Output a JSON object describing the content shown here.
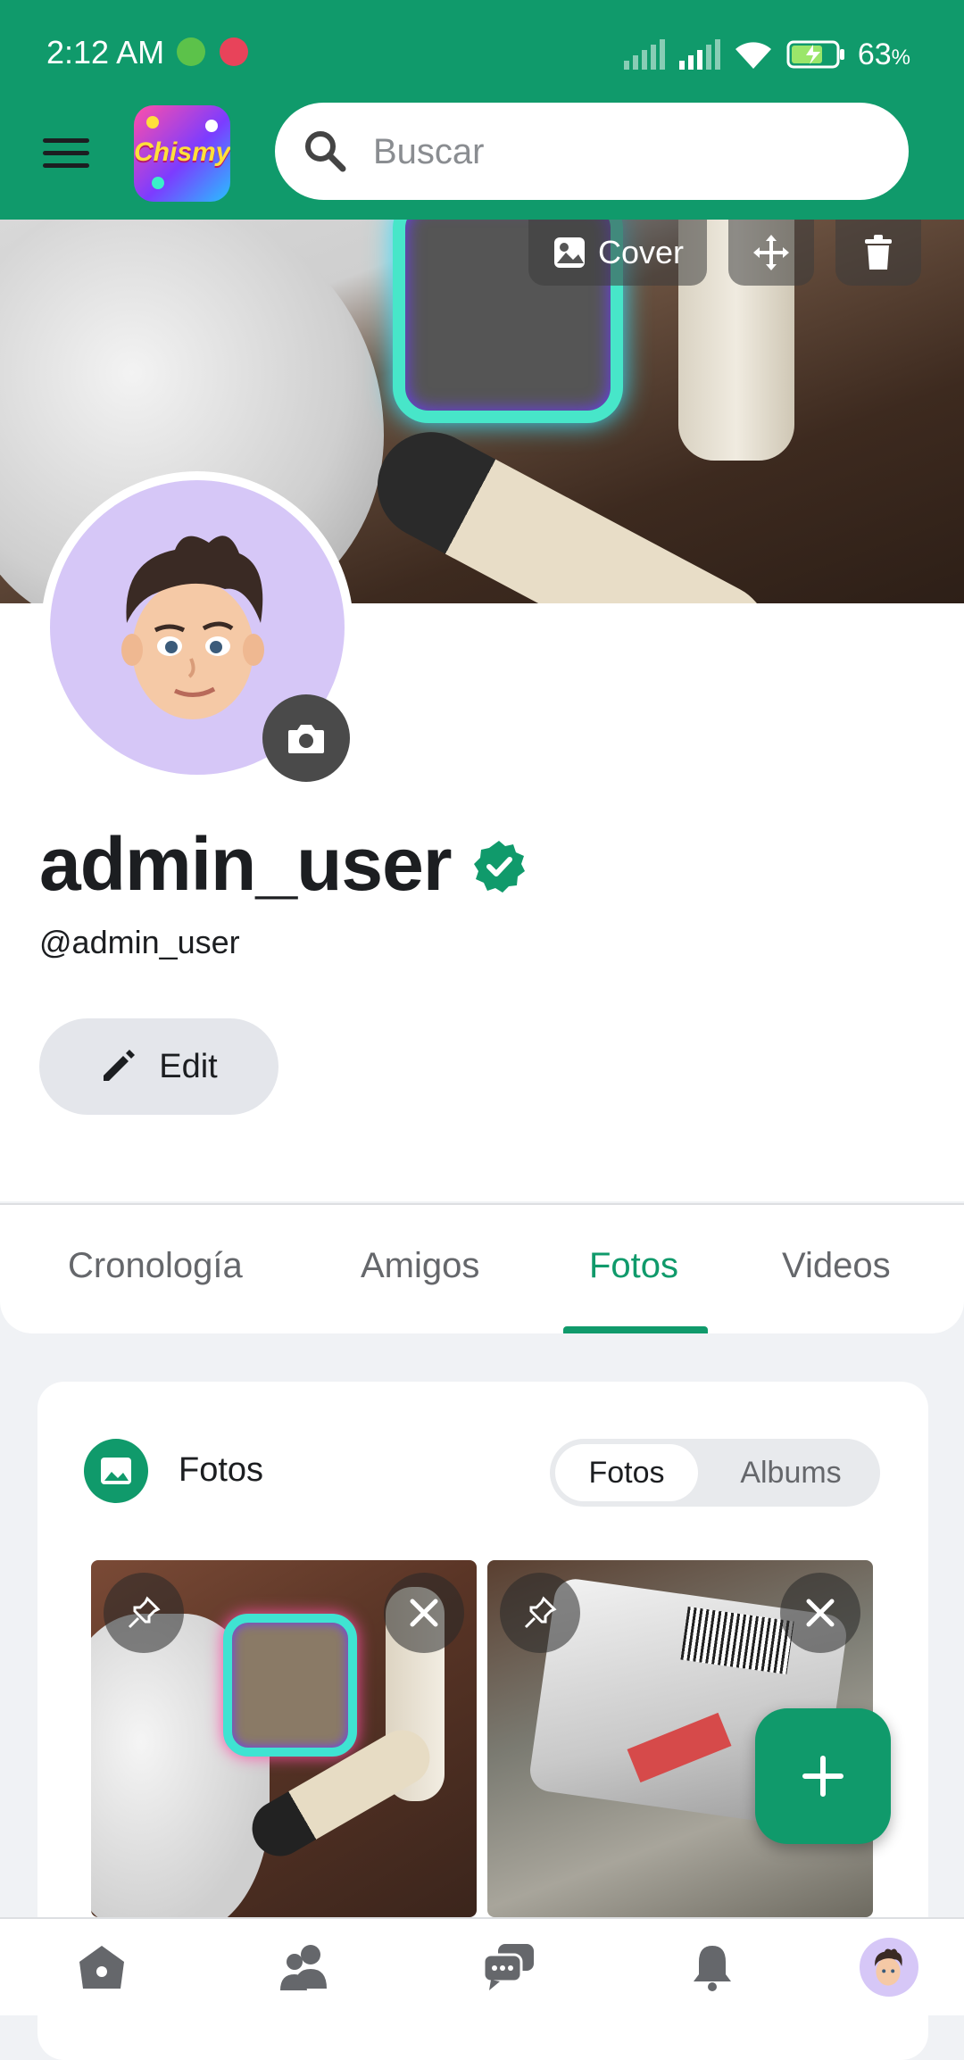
{
  "status_bar": {
    "time": "2:12 AM",
    "battery_percent": "63",
    "battery_unit": "%"
  },
  "app": {
    "logo_text": "Chismy",
    "search": {
      "placeholder": "Buscar"
    }
  },
  "cover": {
    "cover_button_label": "Cover"
  },
  "profile": {
    "display_name": "admin_user",
    "handle": "@admin_user",
    "verified": true,
    "edit_label": "Edit"
  },
  "tabs": [
    {
      "label": "Cronología",
      "active": false
    },
    {
      "label": "Amigos",
      "active": false
    },
    {
      "label": "Fotos",
      "active": true
    },
    {
      "label": "Videos",
      "active": false
    }
  ],
  "photos_card": {
    "title": "Fotos",
    "toggle": {
      "selected": "Fotos",
      "other": "Albums"
    },
    "photo_count_visible": 2
  },
  "bottom_nav": [
    {
      "icon": "home-icon"
    },
    {
      "icon": "friends-icon"
    },
    {
      "icon": "messages-icon"
    },
    {
      "icon": "notifications-icon"
    },
    {
      "icon": "profile-avatar"
    }
  ],
  "colors": {
    "brand": "#109a6b",
    "verified": "#109a6b"
  }
}
